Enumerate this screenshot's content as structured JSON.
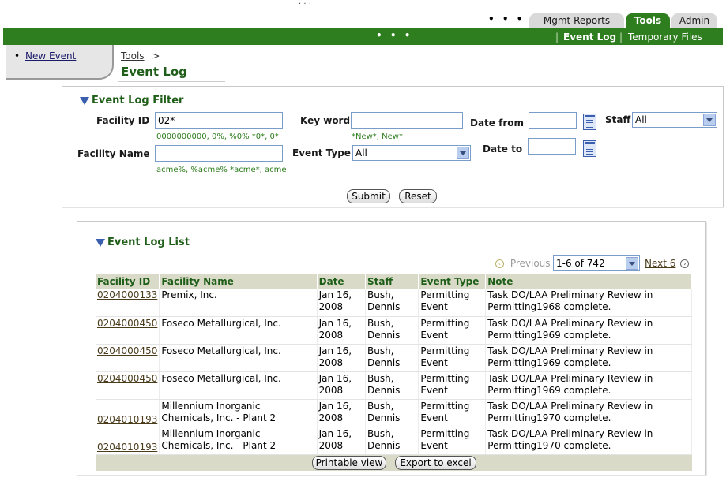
{
  "header": {
    "tabs": [
      {
        "label": "Mgmt Reports"
      },
      {
        "label": "Tools"
      },
      {
        "label": "Admin"
      }
    ],
    "subnav": [
      {
        "label": "Event Log"
      },
      {
        "label": "Temporary Files"
      }
    ],
    "subnav_separator": "|",
    "dots": "• • •",
    "top_dots": "· · ·"
  },
  "sidebar": {
    "items": [
      {
        "label": "New Event"
      }
    ]
  },
  "breadcrumb": {
    "parent": "Tools",
    "separator": ">"
  },
  "page_title": "Event Log",
  "filter": {
    "title": "Event Log Filter",
    "facility_id_label": "Facility ID",
    "facility_id_value": "02*",
    "facility_id_hint": "0000000000, 0%, %0% *0*, 0*",
    "facility_name_label": "Facility Name",
    "facility_name_value": "",
    "facility_name_hint": "acme%, %acme% *acme*, acme",
    "keyword_label": "Key word",
    "keyword_value": "",
    "keyword_hint": "*New*, New*",
    "event_type_label": "Event Type",
    "event_type_value": "All",
    "date_from_label": "Date from",
    "date_from_value": "",
    "date_to_label": "Date to",
    "date_to_value": "",
    "staff_label": "Staff",
    "staff_value": "All",
    "submit_label": "Submit",
    "reset_label": "Reset"
  },
  "list": {
    "title": "Event Log List",
    "previous_label": "Previous",
    "range_value": "1-6 of 742",
    "next_label": "Next 6",
    "columns": [
      "Facility ID",
      "Facility Name",
      "Date",
      "Staff",
      "Event Type",
      "Note"
    ],
    "rows": [
      {
        "facility_id": "0204000133",
        "facility_name": "Premix, Inc.",
        "date": "Jan 16, 2008",
        "staff": "Bush, Dennis",
        "event_type": "Permitting Event",
        "note": "Task DO/LAA Preliminary Review in Permitting1968 complete."
      },
      {
        "facility_id": "0204000450",
        "facility_name": "Foseco Metallurgical, Inc.",
        "date": "Jan 16, 2008",
        "staff": "Bush, Dennis",
        "event_type": "Permitting Event",
        "note": "Task DO/LAA Preliminary Review in Permitting1969 complete."
      },
      {
        "facility_id": "0204000450",
        "facility_name": "Foseco Metallurgical, Inc.",
        "date": "Jan 16, 2008",
        "staff": "Bush, Dennis",
        "event_type": "Permitting Event",
        "note": "Task DO/LAA Preliminary Review in Permitting1969 complete."
      },
      {
        "facility_id": "0204000450",
        "facility_name": "Foseco Metallurgical, Inc.",
        "date": "Jan 16, 2008",
        "staff": "Bush, Dennis",
        "event_type": "Permitting Event",
        "note": "Task DO/LAA Preliminary Review in Permitting1969 complete."
      },
      {
        "facility_id": "0204010193",
        "facility_name": "Millennium Inorganic Chemicals, Inc. - Plant 2",
        "date": "Jan 16, 2008",
        "staff": "Bush, Dennis",
        "event_type": "Permitting Event",
        "note": "Task DO/LAA Preliminary Review in Permitting1970 complete."
      },
      {
        "facility_id": "0204010193",
        "facility_name": "Millennium Inorganic Chemicals, Inc. - Plant 2",
        "date": "Jan 16, 2008",
        "staff": "Bush, Dennis",
        "event_type": "Permitting Event",
        "note": "Task DO/LAA Preliminary Review in Permitting1970 complete."
      }
    ],
    "printable_label": "Printable view",
    "export_label": "Export to excel"
  },
  "colors": {
    "brand_green": "#2e7d1e",
    "title_green": "#1f5e18",
    "header_row": "#d9dbc8"
  },
  "icons": [
    "triangle-down-icon",
    "calendar-icon",
    "previous-arrow-icon",
    "next-arrow-icon",
    "dropdown-arrow-icon"
  ]
}
